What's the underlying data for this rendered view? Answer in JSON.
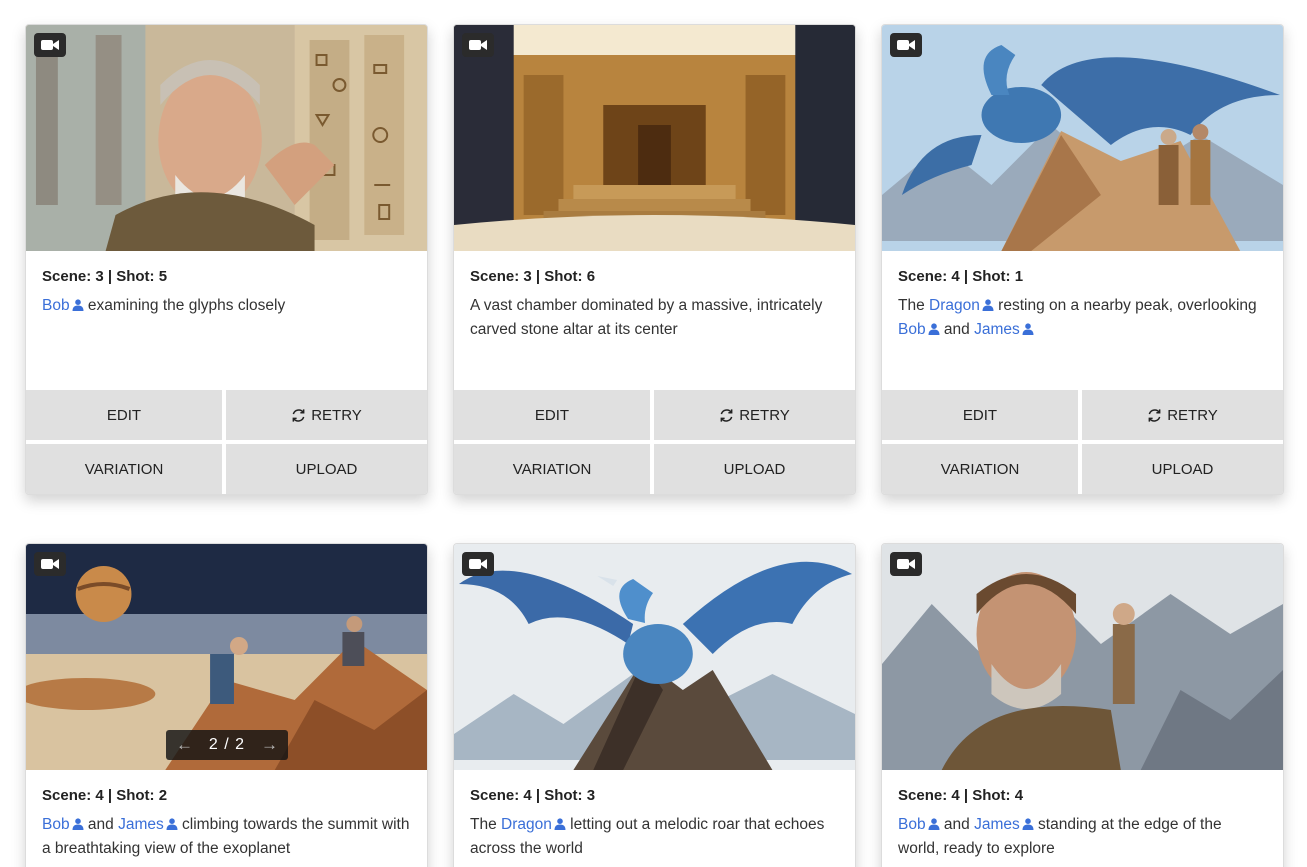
{
  "labels": {
    "edit": "EDIT",
    "retry": "RETRY",
    "variation": "VARIATION",
    "upload": "UPLOAD",
    "and": "and"
  },
  "colors": {
    "character_link": "#3a6fd8",
    "button_bg": "#e0e0e0",
    "badge_bg": "#2b2b2b"
  },
  "cards": [
    {
      "scene_shot": "Scene: 3 | Shot: 5",
      "art": "bearded explorer examining glyphs on a carved temple wall",
      "desc": [
        {
          "char": "Bob"
        },
        {
          "text": " examining the glyphs closely"
        }
      ],
      "has_actions": true
    },
    {
      "scene_shot": "Scene: 3 | Shot: 6",
      "art": "vast stone chamber with a carved altar and steps",
      "desc": [
        {
          "text": "A vast chamber dominated by a massive, intricately carved stone altar at its center"
        }
      ],
      "has_actions": true
    },
    {
      "scene_shot": "Scene: 4 | Shot: 1",
      "art": "blue dragon perched on a peak above two explorers",
      "desc": [
        {
          "text": "The "
        },
        {
          "char": "Dragon"
        },
        {
          "text": " resting on a nearby peak, overlooking "
        },
        {
          "char": "Bob"
        },
        {
          "text": " and "
        },
        {
          "char": "James"
        }
      ],
      "has_actions": true
    },
    {
      "scene_shot": "Scene: 4 | Shot: 2",
      "art": "two climbers on rocky terrain under a planet in the sky",
      "pager": "2 / 2",
      "desc": [
        {
          "char": "Bob"
        },
        {
          "text": " and "
        },
        {
          "char": "James"
        },
        {
          "text": " climbing towards the summit with a breathtaking view of the exoplanet"
        }
      ],
      "has_actions": false
    },
    {
      "scene_shot": "Scene: 4 | Shot: 3",
      "art": "blue dragon roaring on a mountain summit",
      "desc": [
        {
          "text": "The "
        },
        {
          "char": "Dragon"
        },
        {
          "text": " letting out a melodic roar that echoes across the world"
        }
      ],
      "has_actions": false
    },
    {
      "scene_shot": "Scene: 4 | Shot: 4",
      "art": "weathered bearded man and a boy on a misty mountain edge",
      "desc": [
        {
          "char": "Bob"
        },
        {
          "text": " and "
        },
        {
          "char": "James"
        },
        {
          "text": " standing at the edge of the world, ready to explore"
        }
      ],
      "has_actions": false
    }
  ]
}
